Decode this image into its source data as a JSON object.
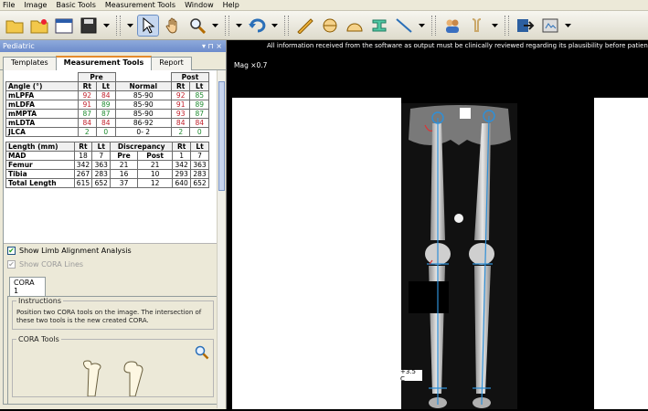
{
  "menu": [
    "File",
    "Image",
    "Basic Tools",
    "Measurement Tools",
    "Window",
    "Help"
  ],
  "panel": {
    "title": "Pediatric",
    "pin_glyph": "▾ ⊓ ×",
    "tabs": [
      "Templates",
      "Measurement Tools",
      "Report"
    ],
    "active_tab": "Measurement Tools"
  },
  "angle_table": {
    "group_headers": [
      "Pre",
      "Post"
    ],
    "headers": [
      "Angle (°)",
      "Rt",
      "Lt",
      "Normal",
      "Rt",
      "Lt"
    ],
    "rows": [
      {
        "label": "mLPFA",
        "pre_rt": "92",
        "pre_lt": "84",
        "normal": "85-90",
        "post_rt": "92",
        "post_lt": "85"
      },
      {
        "label": "mLDFA",
        "pre_rt": "91",
        "pre_lt": "89",
        "normal": "85-90",
        "post_rt": "91",
        "post_lt": "89"
      },
      {
        "label": "mMPTA",
        "pre_rt": "87",
        "pre_lt": "87",
        "normal": "85-90",
        "post_rt": "93",
        "post_lt": "87"
      },
      {
        "label": "mLDTA",
        "pre_rt": "84",
        "pre_lt": "84",
        "normal": "86-92",
        "post_rt": "84",
        "post_lt": "84"
      },
      {
        "label": "JLCA",
        "pre_rt": "2",
        "pre_lt": "0",
        "normal": "0- 2",
        "post_rt": "2",
        "post_lt": "0"
      }
    ]
  },
  "length_table": {
    "headers": [
      "Length (mm)",
      "Rt",
      "Lt",
      "Discrepancy",
      "Rt",
      "Lt"
    ],
    "sub_headers": [
      "Pre",
      "Post"
    ],
    "rows": [
      {
        "label": "MAD",
        "rt": "18",
        "lt": "7",
        "d_pre": "Pre",
        "d_post": "Post",
        "post_rt": "1",
        "post_lt": "7"
      },
      {
        "label": "Femur",
        "rt": "342",
        "lt": "363",
        "d_pre": "21",
        "d_post": "21",
        "post_rt": "342",
        "post_lt": "363"
      },
      {
        "label": "Tibia",
        "rt": "267",
        "lt": "283",
        "d_pre": "16",
        "d_post": "10",
        "post_rt": "293",
        "post_lt": "283"
      },
      {
        "label": "Total Length",
        "rt": "615",
        "lt": "652",
        "d_pre": "37",
        "d_post": "12",
        "post_rt": "640",
        "post_lt": "652"
      }
    ]
  },
  "options": {
    "show_limb": "Show Limb Alignment Analysis",
    "show_cora": "Show CORA Lines"
  },
  "cora": {
    "tab": "CORA 1",
    "instructions_title": "Instructions",
    "instructions_text": "Position two CORA tools on the image. The intersection of these two tools is the new created CORA.",
    "tools_title": "CORA Tools"
  },
  "viewer": {
    "warning": "All information received from the software as output must be clinically reviewed regarding its plausibility before patient treat",
    "magnification": "Mag ×0.7",
    "scale_label": "+3.5 C"
  },
  "colors": {
    "red": "#c0202b",
    "green": "#1e8a2e",
    "axis_blue": "#2f8fd6"
  }
}
